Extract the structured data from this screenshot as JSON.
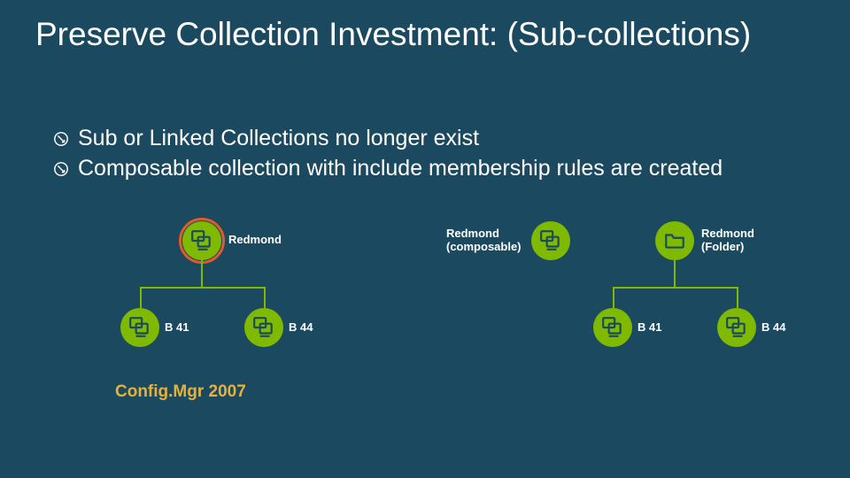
{
  "title": "Preserve Collection Investment: (Sub-collections)",
  "bullets": [
    "Sub or Linked Collections no longer exist",
    "Composable collection with include membership rules are created"
  ],
  "left_tree": {
    "root_label": "Redmond",
    "children": [
      {
        "label": "B 41"
      },
      {
        "label": "B 44"
      }
    ],
    "caption": "Config.Mgr 2007"
  },
  "right_tree": {
    "root_composable_label": "Redmond\n(composable)",
    "root_folder_label": "Redmond\n(Folder)",
    "children": [
      {
        "label": "B 41"
      },
      {
        "label": "B 44"
      }
    ]
  }
}
